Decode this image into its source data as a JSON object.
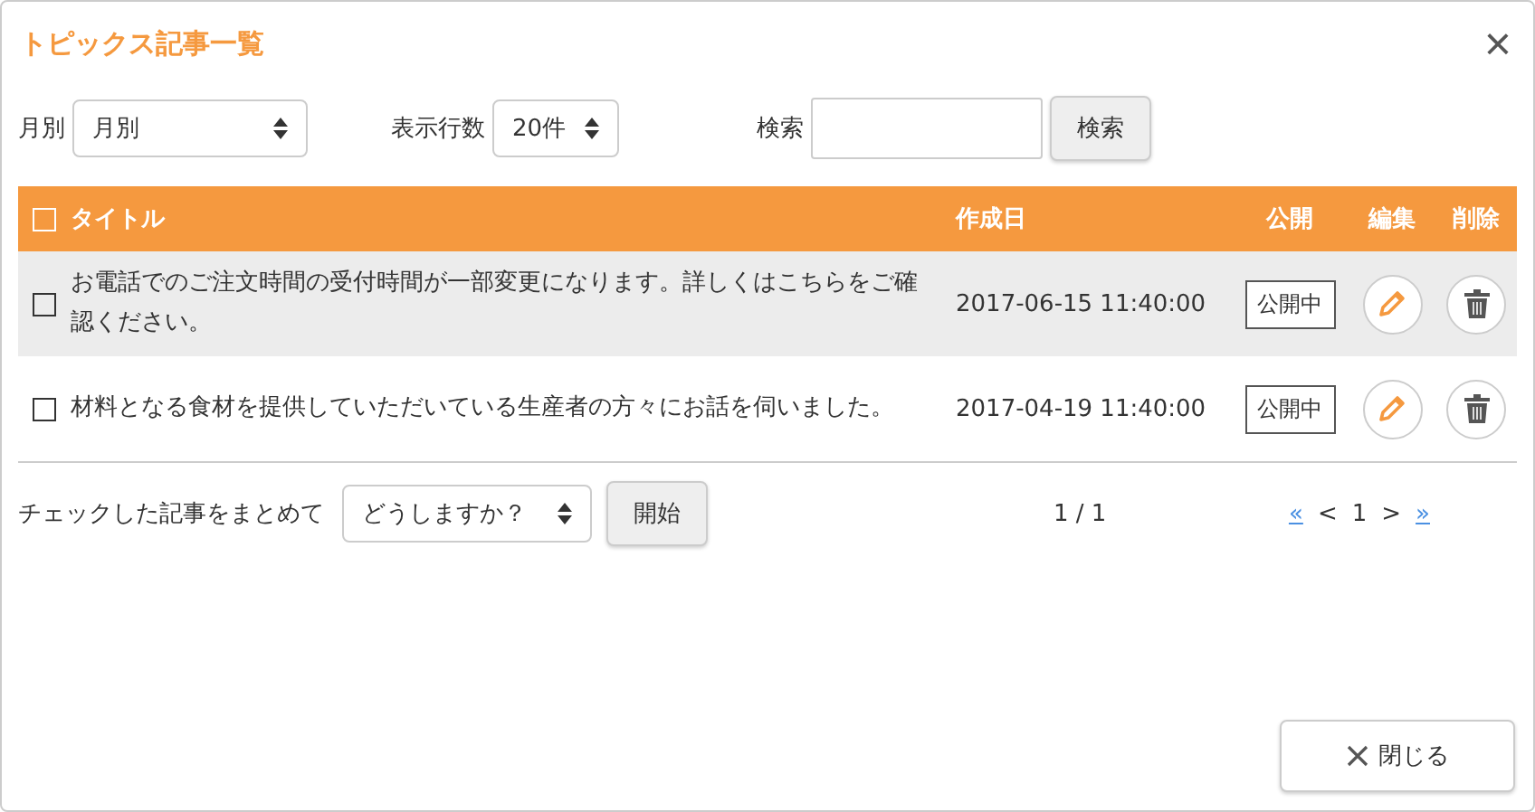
{
  "dialog": {
    "title": "トピックス記事一覧",
    "close_icon_label": "×"
  },
  "filters": {
    "month_label": "月別",
    "month_value": "月別",
    "rows_label": "表示行数",
    "rows_value": "20件",
    "search_label": "検索",
    "search_button": "検索"
  },
  "table": {
    "select_all_checked": false,
    "columns": [
      "タイトル",
      "作成日",
      "公開",
      "編集",
      "削除"
    ],
    "rows": [
      {
        "title": "お電話でのご注文時間の受付時間が一部変更になります。詳しくはこちらをご確認ください。",
        "date": "2017-06-15 11:40:00",
        "status": "公開中",
        "checked": false,
        "highlighted": true
      },
      {
        "title": "材料となる食材を提供していただいている生産者の方々にお話を伺いました。",
        "date": "2017-04-19 11:40:00",
        "status": "公開中",
        "checked": false,
        "highlighted": false
      }
    ]
  },
  "bulk": {
    "label": "チェックした記事をまとめて",
    "select_value": "どうしますか？",
    "button": "開始"
  },
  "pagination": {
    "page_info": "1 / 1",
    "first": "«",
    "prev": "<",
    "current": "1",
    "next": ">",
    "last": "»"
  },
  "footer": {
    "close_button": "閉じる"
  }
}
